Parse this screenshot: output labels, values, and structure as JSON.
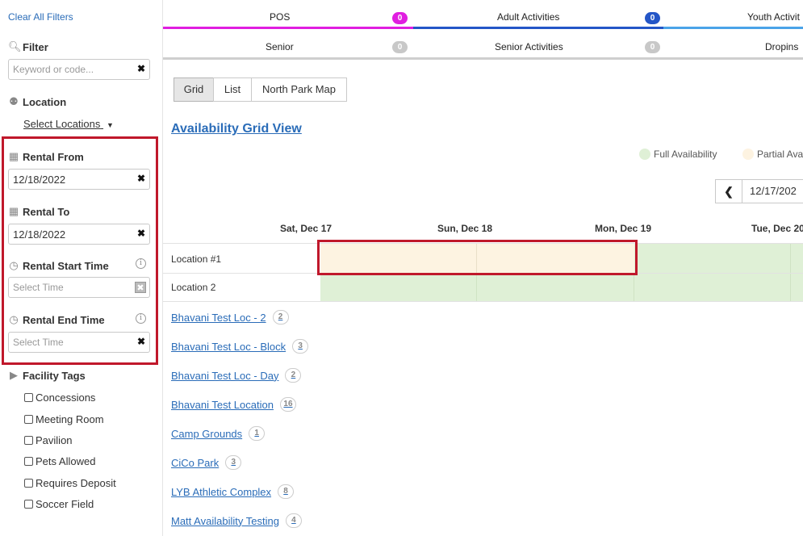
{
  "sidebar": {
    "clear_all": "Clear All Filters",
    "filter_title": "Filter",
    "keyword_placeholder": "Keyword or code...",
    "location_title": "Location",
    "select_locations": "Select Locations",
    "rental_from_title": "Rental From",
    "rental_from_value": "12/18/2022",
    "rental_to_title": "Rental To",
    "rental_to_value": "12/18/2022",
    "start_time_title": "Rental Start Time",
    "start_time_placeholder": "Select Time",
    "end_time_title": "Rental End Time",
    "end_time_placeholder": "Select Time",
    "tags_title": "Facility Tags",
    "tags": [
      "Concessions",
      "Meeting Room",
      "Pavilion",
      "Pets Allowed",
      "Requires Deposit",
      "Soccer Field"
    ]
  },
  "tabs_row1": [
    {
      "label": "POS",
      "count": "0",
      "color": "#e01ee0"
    },
    {
      "label": "Adult Activities",
      "count": "0",
      "color": "#2456c7"
    },
    {
      "label": "Youth Activit",
      "count": "",
      "color": "#4aa3e8"
    }
  ],
  "tabs_row2": [
    {
      "label": "Senior",
      "count": "0"
    },
    {
      "label": "Senior Activities",
      "count": "0"
    },
    {
      "label": "Dropins",
      "count": ""
    }
  ],
  "views": [
    "Grid",
    "List",
    "North Park Map"
  ],
  "grid": {
    "title": "Availability Grid View",
    "legend_full": "Full Availability",
    "legend_partial": "Partial Ava",
    "date_value": "12/17/202",
    "prev_icon": "chevron-left-icon",
    "days": [
      "Sat, Dec 17",
      "Sun, Dec 18",
      "Mon, Dec 19",
      "Tue, Dec 20"
    ],
    "rows": [
      "Location #1",
      "Location 2"
    ],
    "colors": {
      "full": "#dff0d6",
      "partial": "#fdf3e1",
      "highlight": "#c0182b"
    }
  },
  "locations": [
    {
      "name": "Bhavani Test Loc - 2",
      "count": "2"
    },
    {
      "name": "Bhavani Test Loc - Block",
      "count": "3"
    },
    {
      "name": "Bhavani Test Loc - Day",
      "count": "2"
    },
    {
      "name": "Bhavani Test Location",
      "count": "16"
    },
    {
      "name": "Camp Grounds",
      "count": "1"
    },
    {
      "name": "CiCo Park",
      "count": "3"
    },
    {
      "name": "LYB Athletic Complex",
      "count": "8"
    },
    {
      "name": "Matt Availability Testing",
      "count": "4"
    }
  ]
}
